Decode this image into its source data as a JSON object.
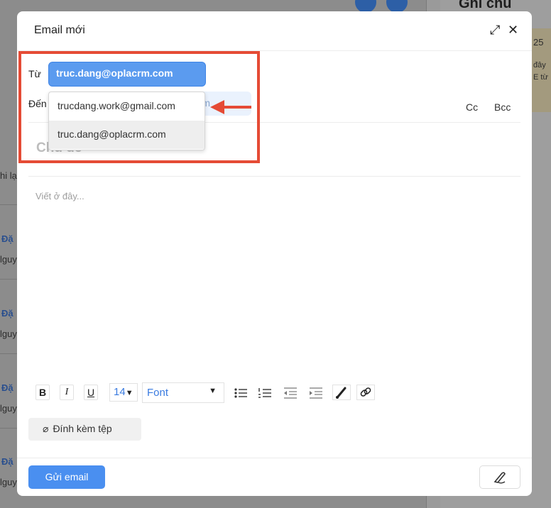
{
  "background": {
    "panel_title": "Ghi chú",
    "card_number": "25",
    "card_text_1": "đây",
    "card_text_2": "E từ",
    "left_snippet_1": "hi lạ",
    "row_a_title": "Đặ",
    "row_a_sub": "lguy",
    "row_b_title": "Đặ",
    "row_b_sub": "lguy",
    "row_c_title": "Đặ",
    "row_c_sub": "lguy",
    "row_d_title": "Đặ",
    "row_d_sub": "lguy"
  },
  "modal": {
    "title": "Email mới",
    "expand_icon": "expand-icon",
    "close_icon": "close-icon",
    "from_label": "Từ",
    "from_value": "truc.dang@oplacrm.com",
    "to_label": "Đến",
    "to_partial_text": "m",
    "cc_label": "Cc",
    "bcc_label": "Bcc",
    "subject_placeholder": "Chủ đề",
    "body_placeholder": "Viết ở đây...",
    "from_options": [
      "trucdang.work@gmail.com",
      "truc.dang@oplacrm.com"
    ],
    "toolbar": {
      "bold": "B",
      "italic": "I",
      "underline": "U",
      "font_size": "14",
      "font": "Font",
      "icons": [
        "bullet-list-icon",
        "numbered-list-icon",
        "outdent-icon",
        "indent-icon",
        "brush-icon",
        "link-icon"
      ]
    },
    "attach_label": "Đính kèm tệp",
    "send_label": "Gửi email",
    "signature_icon": "signature-icon"
  },
  "colors": {
    "accent": "#4a8ff0",
    "highlight": "#e54b35"
  }
}
